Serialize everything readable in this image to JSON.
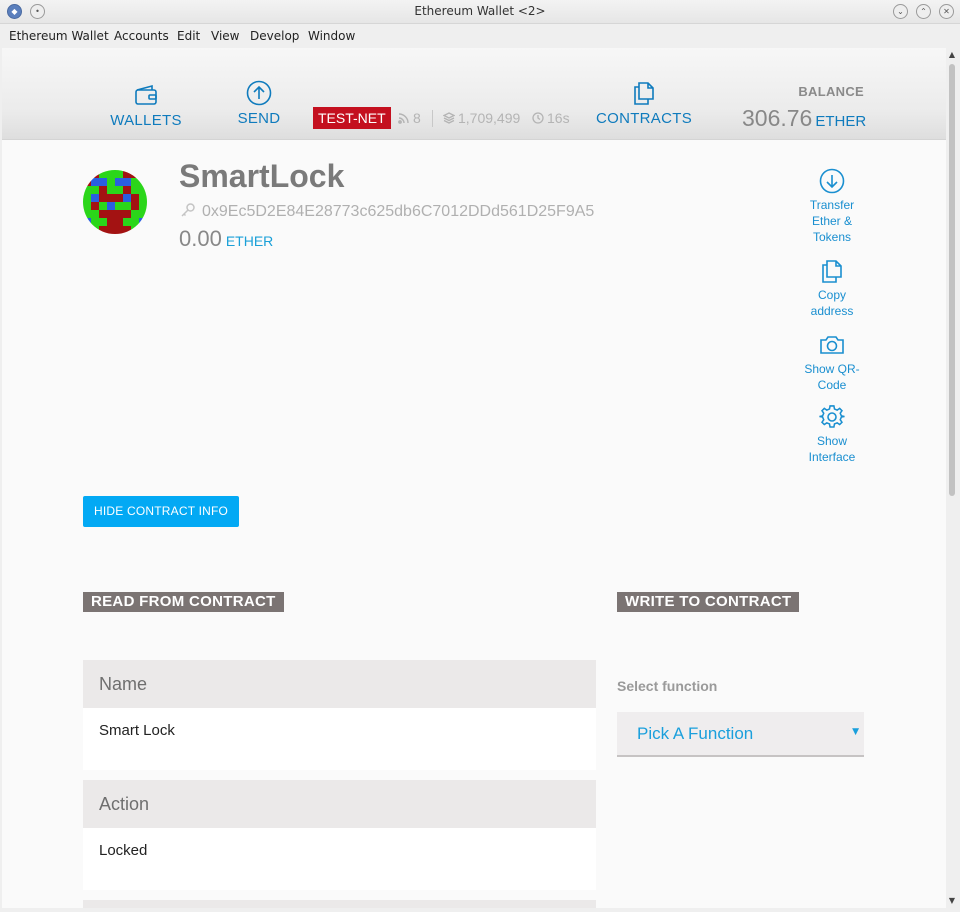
{
  "window": {
    "title": "Ethereum Wallet <2>"
  },
  "menu": [
    "Ethereum Wallet",
    "Accounts",
    "Edit",
    "View",
    "Develop",
    "Window"
  ],
  "header": {
    "nav": {
      "wallets": "WALLETS",
      "send": "SEND",
      "contracts": "CONTRACTS"
    },
    "network_badge": "TEST-NET",
    "peers": "8",
    "block": "1,709,499",
    "time_since_block": "16s",
    "balance_label": "BALANCE",
    "balance_amount": "306.76",
    "balance_unit": "ETHER"
  },
  "account": {
    "name": "SmartLock",
    "address": "0x9Ec5D2E84E28773c625db6C7012DDd561D25F9A5",
    "balance": "0.00",
    "balance_unit": "ETHER"
  },
  "actions": {
    "transfer": [
      "Transfer",
      "Ether &",
      "Tokens"
    ],
    "copy": [
      "Copy",
      "address"
    ],
    "qr": [
      "Show QR-",
      "Code"
    ],
    "interface": [
      "Show",
      "Interface"
    ]
  },
  "hide_contract_info": "HIDE CONTRACT INFO",
  "read_section": {
    "title": "READ FROM CONTRACT",
    "fields": [
      {
        "label": "Name",
        "value": "Smart Lock"
      },
      {
        "label": "Action",
        "value": "Locked"
      }
    ]
  },
  "write_section": {
    "title": "WRITE TO CONTRACT",
    "select_label": "Select function",
    "select_value": "Pick A Function"
  },
  "colors": {
    "accent": "#0f7bbd",
    "testnet": "#c4101f",
    "button": "#03a9f4",
    "section_title_bg": "#7b7473"
  },
  "identicon": {
    "colors": {
      "r": "#a31212",
      "g": "#2bd61a",
      "b": "#2a5fe0"
    },
    "grid": [
      "rrgggrrr",
      "rbbgbbgg",
      "ggrggrgg",
      "gbrrrbrg",
      "grgbggrg",
      "ggrrrrgg",
      "bggrrggb",
      "ggrrrrgg"
    ]
  }
}
